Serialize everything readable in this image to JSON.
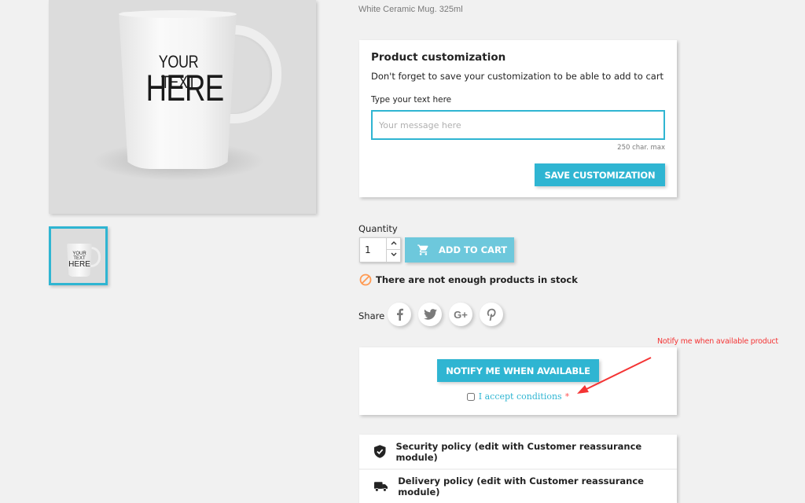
{
  "product": {
    "short_description": "White Ceramic Mug. 325ml",
    "image_text_line1": "YOUR TEXT",
    "image_text_line2": "HERE",
    "thumbnail_text_line1": "YOUR TEXT",
    "thumbnail_text_line2": "HERE"
  },
  "customization": {
    "title": "Product customization",
    "note": "Don't forget to save your customization to be able to add to cart",
    "field_label": "Type your text here",
    "field_value": "",
    "field_placeholder": "Your message here",
    "char_limit": "250 char. max",
    "save_label": "SAVE CUSTOMIZATION"
  },
  "purchase": {
    "quantity_label": "Quantity",
    "quantity_value": "1",
    "qty_up_icon": "chevron-up",
    "qty_down_icon": "chevron-down",
    "add_to_cart_label": "ADD TO CART",
    "cart_icon": "shopping-cart",
    "stock_message": "There are not enough products in stock",
    "stock_icon": "no-entry"
  },
  "share": {
    "label": "Share",
    "networks": [
      {
        "name": "facebook",
        "glyph": "f"
      },
      {
        "name": "twitter",
        "glyph": "bird"
      },
      {
        "name": "google-plus",
        "glyph": "G+"
      },
      {
        "name": "pinterest",
        "glyph": "P"
      }
    ]
  },
  "notify": {
    "button_label": "NOTIFY ME WHEN AVAILABLE",
    "accept_label": "I accept conditions",
    "required_mark": "*",
    "accepted": false
  },
  "annotation": {
    "text": "Notify me when available product",
    "color": "#f43434"
  },
  "reassurance": {
    "items": [
      {
        "icon": "shield-check",
        "label": "Security policy (edit with Customer reassurance module)"
      },
      {
        "icon": "truck",
        "label": "Delivery policy (edit with Customer reassurance module)"
      }
    ]
  },
  "theme": {
    "primary": "#2fb5d2",
    "primary_disabled": "#6dc8dc",
    "background": "#f1f1f1",
    "warning": "#ff9a52"
  }
}
